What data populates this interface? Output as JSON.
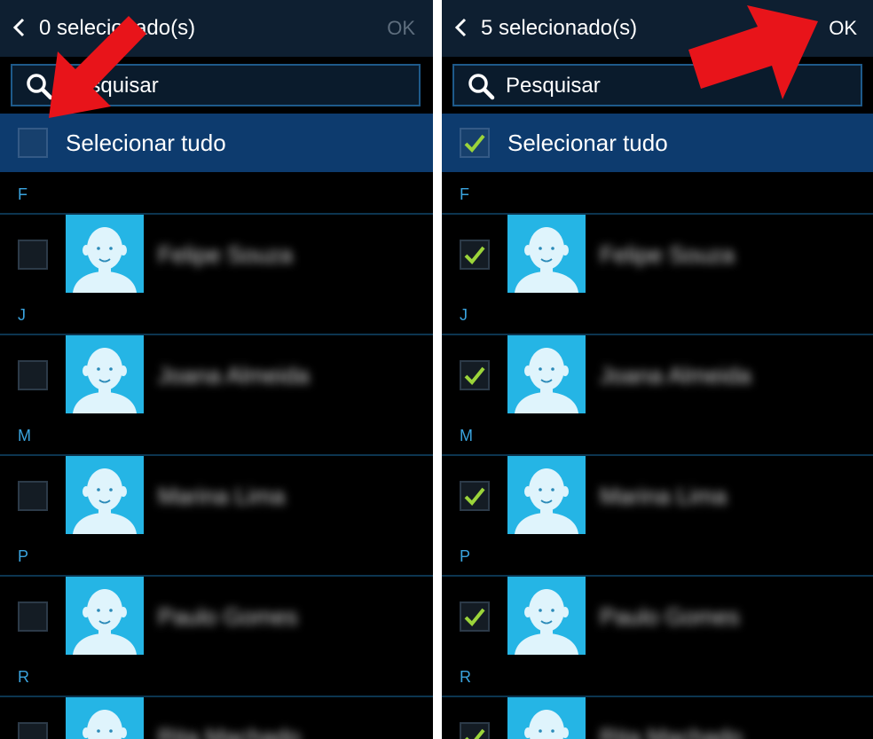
{
  "left": {
    "title": "0 selecionado(s)",
    "ok_label": "OK",
    "search_placeholder": "Pesquisar",
    "select_all_label": "Selecionar tudo",
    "select_all_checked": false,
    "sections": [
      {
        "letter": "F",
        "name": "Felipe Souza",
        "checked": false
      },
      {
        "letter": "J",
        "name": "Joana Almeida",
        "checked": false
      },
      {
        "letter": "M",
        "name": "Marina Lima",
        "checked": false
      },
      {
        "letter": "P",
        "name": "Paulo Gomes",
        "checked": false
      },
      {
        "letter": "R",
        "name": "Rita Machado",
        "checked": false
      }
    ]
  },
  "right": {
    "title": "5 selecionado(s)",
    "ok_label": "OK",
    "search_placeholder": "Pesquisar",
    "select_all_label": "Selecionar tudo",
    "select_all_checked": true,
    "sections": [
      {
        "letter": "F",
        "name": "Felipe Souza",
        "checked": true
      },
      {
        "letter": "J",
        "name": "Joana Almeida",
        "checked": true
      },
      {
        "letter": "M",
        "name": "Marina Lima",
        "checked": true
      },
      {
        "letter": "P",
        "name": "Paulo Gomes",
        "checked": true
      },
      {
        "letter": "R",
        "name": "Rita Machado",
        "checked": true
      }
    ]
  },
  "colors": {
    "accent_blue": "#25b5e5",
    "check_green": "#9bd43a",
    "annotation_red": "#e8141a"
  },
  "icons": [
    "back-chevron-icon",
    "search-icon",
    "checkmark-icon",
    "contact-avatar-icon",
    "red-arrow"
  ]
}
